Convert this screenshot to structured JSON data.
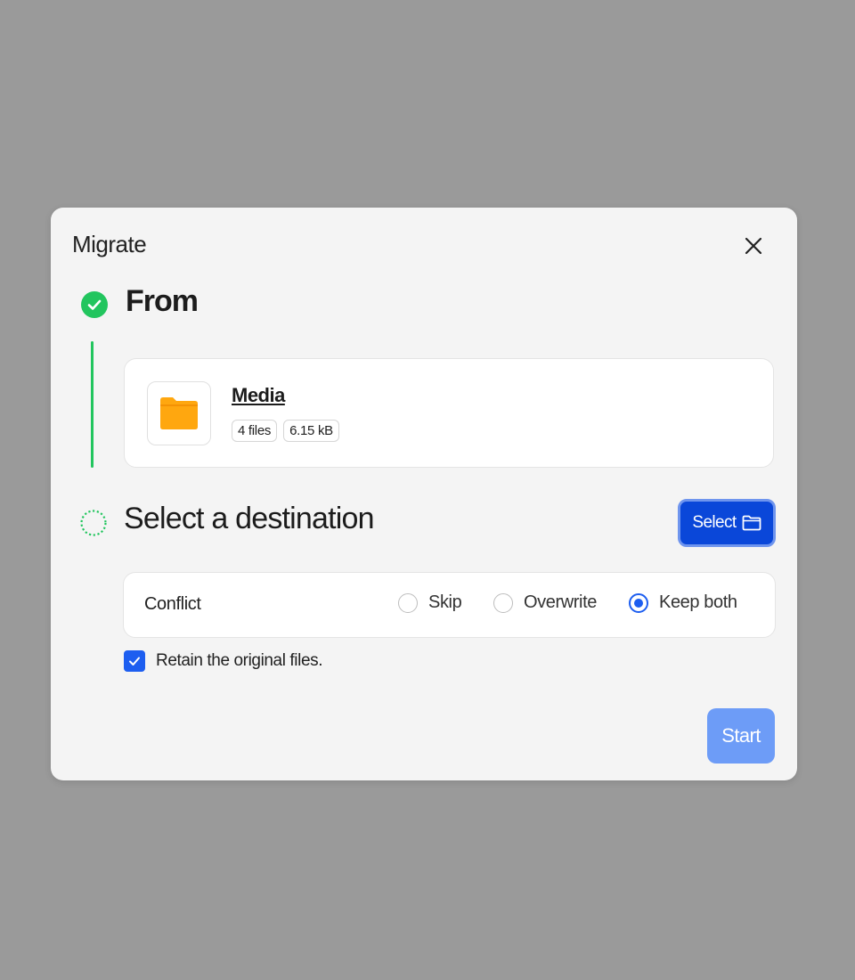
{
  "dialog": {
    "title": "Migrate",
    "close_icon": "close-icon"
  },
  "step_from": {
    "title": "From",
    "status": "complete",
    "status_icon": "check-circle-icon",
    "status_color": "#22c55e",
    "source": {
      "icon": "folder-icon",
      "icon_color": "#ffa70f",
      "name": "Media",
      "file_count": "4 files",
      "size": "6.15 kB"
    }
  },
  "step_destination": {
    "title": "Select a destination",
    "status": "pending",
    "status_icon": "dotted-circle-icon",
    "select_button": {
      "label": "Select",
      "icon": "folder-outline-icon",
      "color": "#0a47d9"
    }
  },
  "conflict": {
    "label": "Conflict",
    "options": [
      {
        "label": "Skip",
        "selected": false
      },
      {
        "label": "Overwrite",
        "selected": false
      },
      {
        "label": "Keep both",
        "selected": true
      }
    ]
  },
  "retain": {
    "label": "Retain the original files.",
    "checked": true
  },
  "start_button": {
    "label": "Start",
    "color": "#6d9cf7"
  }
}
